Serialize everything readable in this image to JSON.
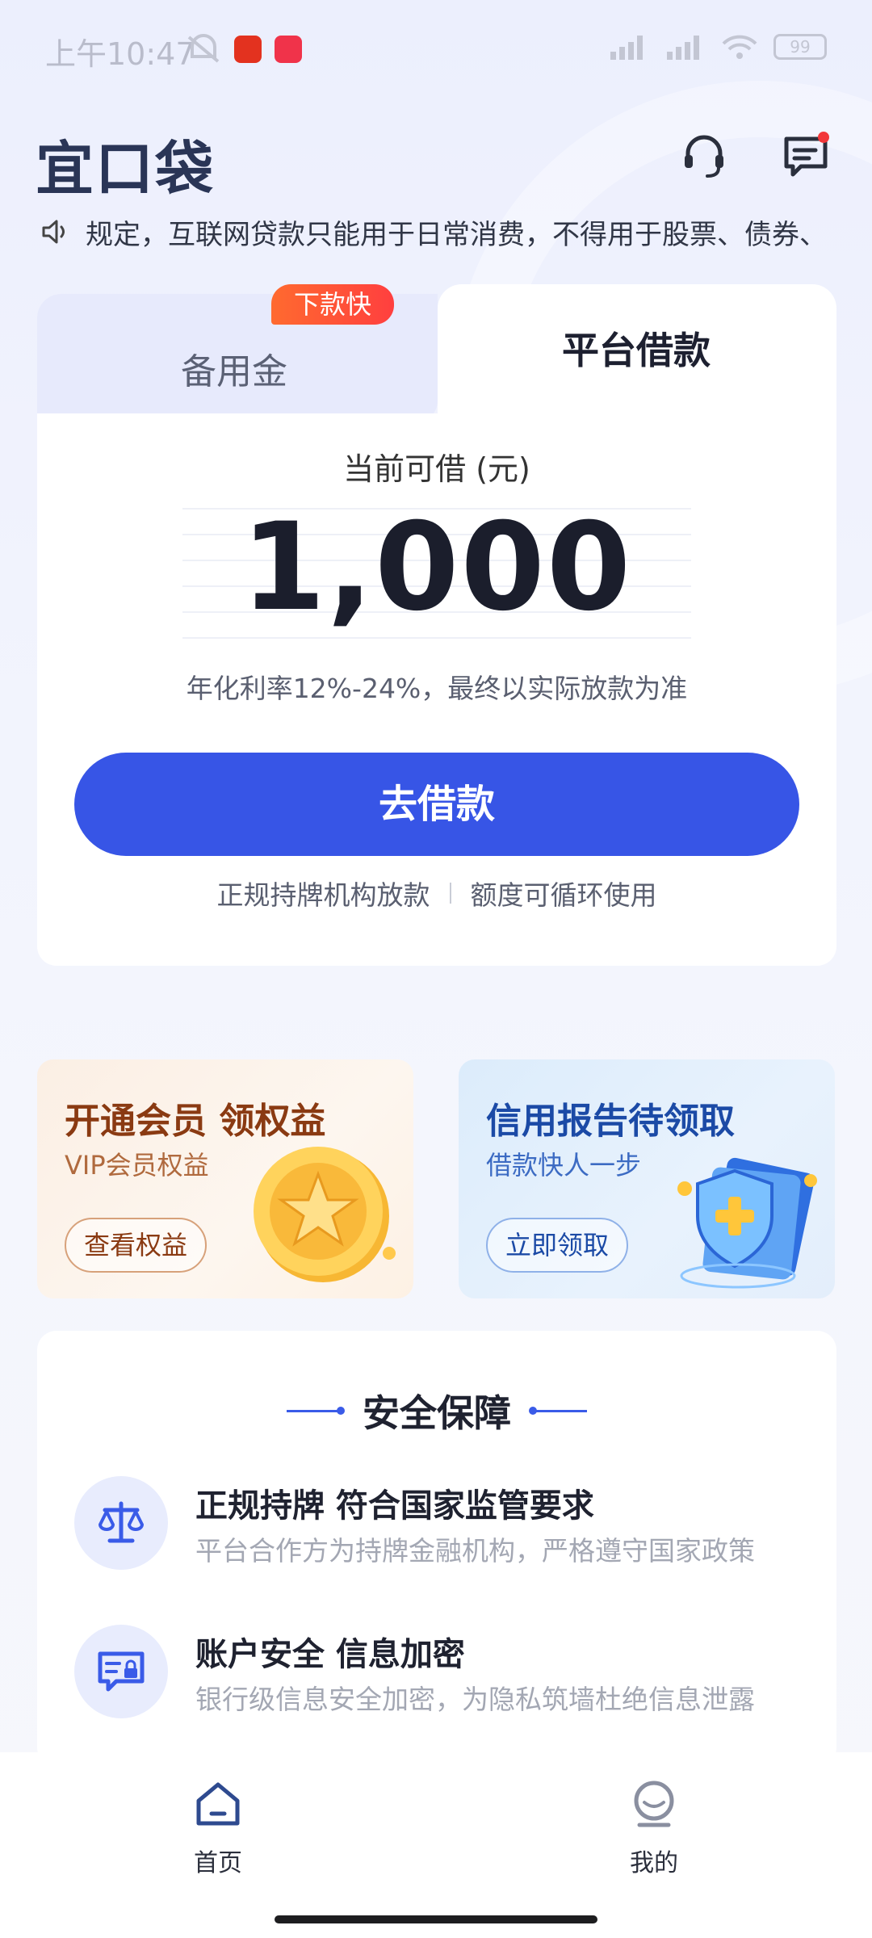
{
  "status_bar": {
    "time": "上午10:47",
    "battery": "99"
  },
  "header": {
    "logo": "宜口袋",
    "icons": [
      "headset-icon",
      "message-icon"
    ]
  },
  "notice": {
    "text": "规定，互联网贷款只能用于日常消费，不得用于股票、债券、"
  },
  "loan_card": {
    "tabs": [
      {
        "label": "备用金",
        "badge": "下款快",
        "active": false
      },
      {
        "label": "平台借款",
        "active": true
      }
    ],
    "amount_label": "当前可借 (元)",
    "amount": "1,000",
    "rate_text": "年化利率12%-24%，最终以实际放款为准",
    "borrow_button": "去借款",
    "footer": [
      "正规持牌机构放款",
      "额度可循环使用"
    ]
  },
  "promos": [
    {
      "title": "开通会员 领权益",
      "subtitle": "VIP会员权益",
      "button": "查看权益"
    },
    {
      "title": "信用报告待领取",
      "subtitle": "借款快人一步",
      "button": "立即领取"
    }
  ],
  "security": {
    "title": "安全保障",
    "items": [
      {
        "title": "正规持牌 符合国家监管要求",
        "desc": "平台合作方为持牌金融机构，严格遵守国家政策",
        "icon": "scale-icon"
      },
      {
        "title": "账户安全 信息加密",
        "desc": "银行级信息安全加密，为隐私筑墙杜绝信息泄露",
        "icon": "secure-id-icon"
      }
    ]
  },
  "bottom_nav": [
    {
      "label": "首页",
      "icon": "home-icon",
      "active": true
    },
    {
      "label": "我的",
      "icon": "profile-icon",
      "active": false
    }
  ],
  "colors": {
    "primary": "#3755e6",
    "badge": "#ff4b35",
    "text_dark": "#1b1e2c"
  }
}
